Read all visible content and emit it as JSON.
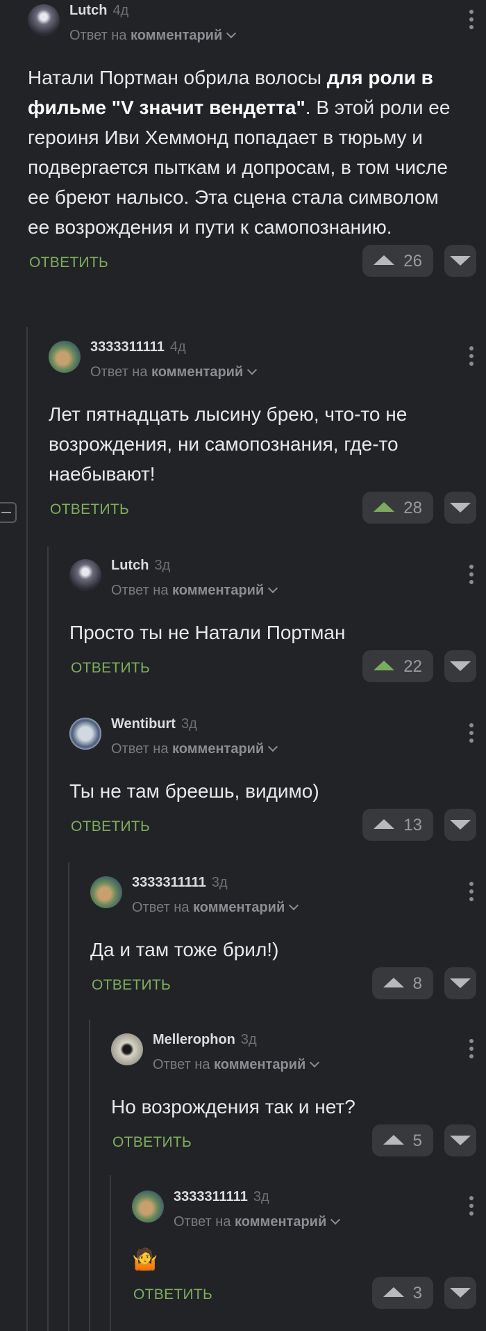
{
  "comments": [
    {
      "author": "Lutch",
      "age": "4д",
      "reply_prefix": "Ответ на",
      "reply_target": "комментарий",
      "text_parts": [
        {
          "t": "Натали Портман обрила волосы ",
          "b": false
        },
        {
          "t": "для роли в фильме \"V значит вендетта\"",
          "b": true
        },
        {
          "t": ". В этой роли ее героиня Иви Хеммонд попадает в тюрьму и подвергается пыткам и допросам, в том числе ее бреют налысо. Эта сцена стала символом ее возрождения и пути к самопознанию.",
          "b": false
        }
      ],
      "reply_label": "ОТВЕТИТЬ",
      "votes": "26",
      "upvoted": false
    },
    {
      "author": "3333311111",
      "age": "4д",
      "reply_prefix": "Ответ на",
      "reply_target": "комментарий",
      "text": "Лет пятнадцать лысину брею, что-то не возрождения, ни самопознания, где-то наебывают!",
      "reply_label": "ОТВЕТИТЬ",
      "votes": "28",
      "upvoted": true
    },
    {
      "author": "Lutch",
      "age": "3д",
      "reply_prefix": "Ответ на",
      "reply_target": "комментарий",
      "text": "Просто ты не Натали Портман",
      "reply_label": "ОТВЕТИТЬ",
      "votes": "22",
      "upvoted": true
    },
    {
      "author": "Wentiburt",
      "age": "3д",
      "reply_prefix": "Ответ на",
      "reply_target": "комментарий",
      "text": "Ты не там бреешь, видимо)",
      "reply_label": "ОТВЕТИТЬ",
      "votes": "13",
      "upvoted": false
    },
    {
      "author": "3333311111",
      "age": "3д",
      "reply_prefix": "Ответ на",
      "reply_target": "комментарий",
      "text": "Да и там тоже брил!)",
      "reply_label": "ОТВЕТИТЬ",
      "votes": "8",
      "upvoted": false
    },
    {
      "author": "Mellerophon",
      "age": "3д",
      "reply_prefix": "Ответ на",
      "reply_target": "комментарий",
      "text": "Но возрождения так и нет?",
      "reply_label": "ОТВЕТИТЬ",
      "votes": "5",
      "upvoted": false
    },
    {
      "author": "3333311111",
      "age": "3д",
      "reply_prefix": "Ответ на",
      "reply_target": "комментарий",
      "text": "🤷",
      "reply_label": "ОТВЕТИТЬ",
      "votes": "3",
      "upvoted": false
    }
  ],
  "icons": {
    "upvote": "arrow-up-icon",
    "downvote": "arrow-down-icon",
    "menu": "more-vertical-icon",
    "expand": "chevron-down-icon",
    "collapse": "collapse-thread-icon"
  },
  "colors": {
    "background": "#222326",
    "accent_green": "#79ad5b",
    "vote_bg": "#38393d"
  }
}
